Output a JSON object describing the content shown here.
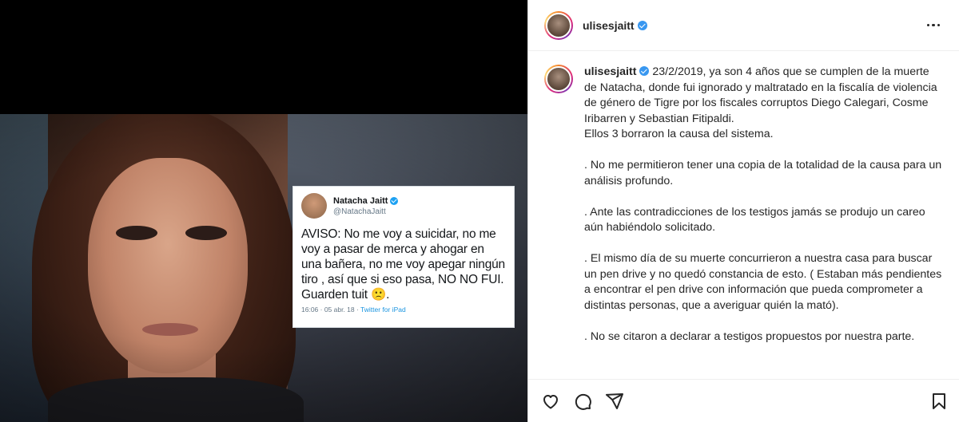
{
  "post": {
    "username": "ulisesjaitt",
    "caption_user": "ulisesjaitt",
    "caption_text": " 23/2/2019, ya son 4 años que se cumplen de la muerte de Natacha, donde fui ignorado y maltratado en la fiscalía de violencia de género de Tigre por los fiscales corruptos Diego Calegari, Cosme Iribarren y Sebastian Fitipaldi.\nEllos 3 borraron la causa del sistema.\n\n. No me permitieron tener una copia de la totalidad de la causa para un análisis profundo.\n\n. Ante las contradicciones de los testigos jamás se produjo un careo aún habiéndolo solicitado.\n\n. El mismo día de su muerte concurrieron a nuestra casa para buscar un pen drive y no quedó constancia de esto. ( Estaban más pendientes a encontrar el pen drive con información que pueda comprometer a distintas personas, que a averiguar quién la mató).\n\n. No se citaron a declarar a testigos propuestos por nuestra parte.",
    "icons": {
      "more": "more-options-icon",
      "like": "heart-icon",
      "comment": "comment-icon",
      "share": "share-icon",
      "save": "bookmark-icon",
      "verified": "verified-badge-icon"
    }
  },
  "media": {
    "tweet": {
      "name": "Natacha Jaitt",
      "handle": "@NatachaJaitt",
      "text": "AVISO: No me voy a suicidar, no me voy a pasar de merca y ahogar en una bañera, no me voy apegar ningún tiro , así que si eso pasa, NO NO FUI. Guarden tuit 🙁.",
      "timestamp": "16:06 · 05 abr. 18 · ",
      "source": "Twitter for iPad"
    }
  },
  "colors": {
    "verified_ig": "#3897f0",
    "verified_tw": "#1da1f2",
    "text": "#262626"
  }
}
